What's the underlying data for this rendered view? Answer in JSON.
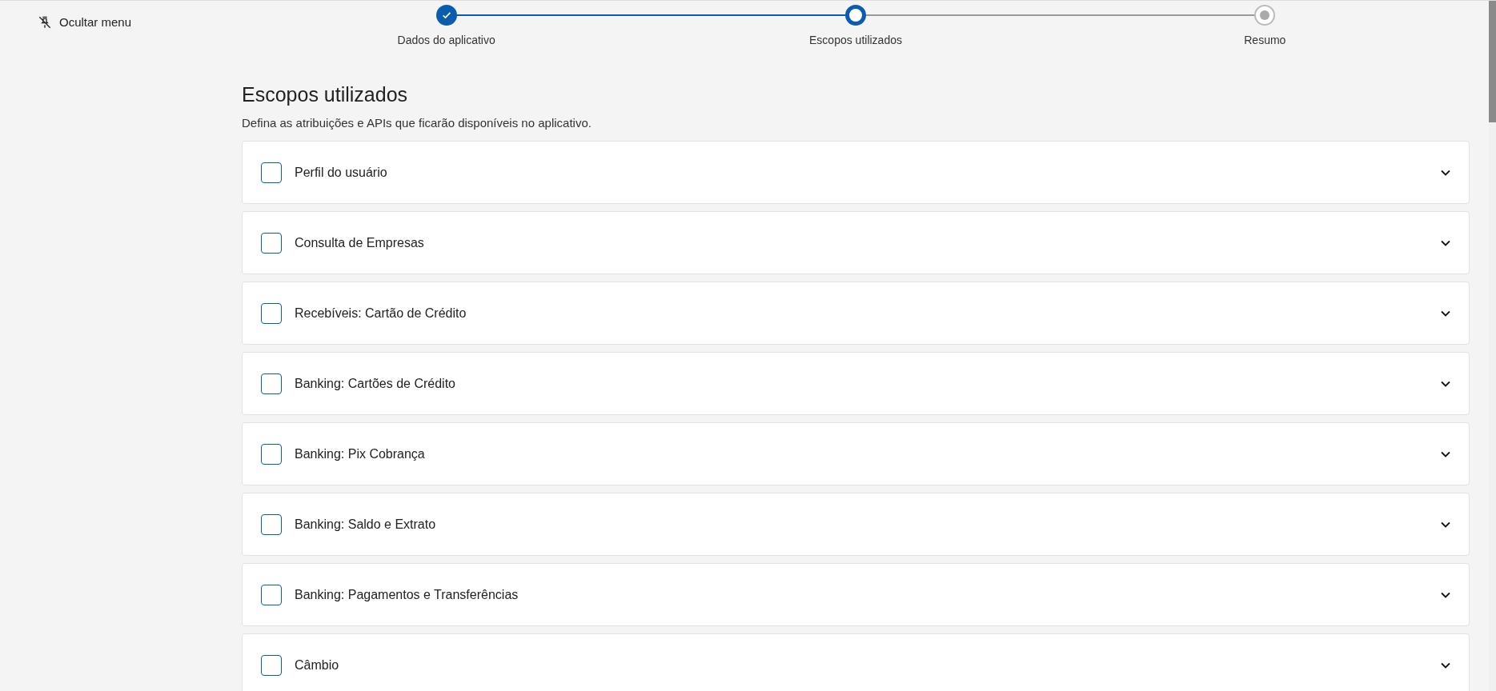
{
  "sidebar": {
    "toggle_label": "Ocultar menu"
  },
  "stepper": [
    {
      "label": "Dados do aplicativo",
      "completed": true,
      "selected": false
    },
    {
      "label": "Escopos utilizados",
      "completed": false,
      "selected": true
    },
    {
      "label": "Resumo",
      "completed": false,
      "selected": false
    }
  ],
  "heading": "Escopos utilizados",
  "description": "Defina as atribuições e APIs que ficarão disponíveis no aplicativo.",
  "scopes": [
    {
      "label": "Perfil do usuário",
      "checked": false,
      "expanded": false
    },
    {
      "label": "Consulta de Empresas",
      "checked": false,
      "expanded": false
    },
    {
      "label": "Recebíveis: Cartão de Crédito",
      "checked": false,
      "expanded": false
    },
    {
      "label": "Banking: Cartões de Crédito",
      "checked": false,
      "expanded": false
    },
    {
      "label": "Banking: Pix Cobrança",
      "checked": false,
      "expanded": false
    },
    {
      "label": "Banking: Saldo e Extrato",
      "checked": false,
      "expanded": false
    },
    {
      "label": "Banking: Pagamentos e Transferências",
      "checked": false,
      "expanded": false
    },
    {
      "label": "Câmbio",
      "checked": false,
      "expanded": false
    }
  ]
}
